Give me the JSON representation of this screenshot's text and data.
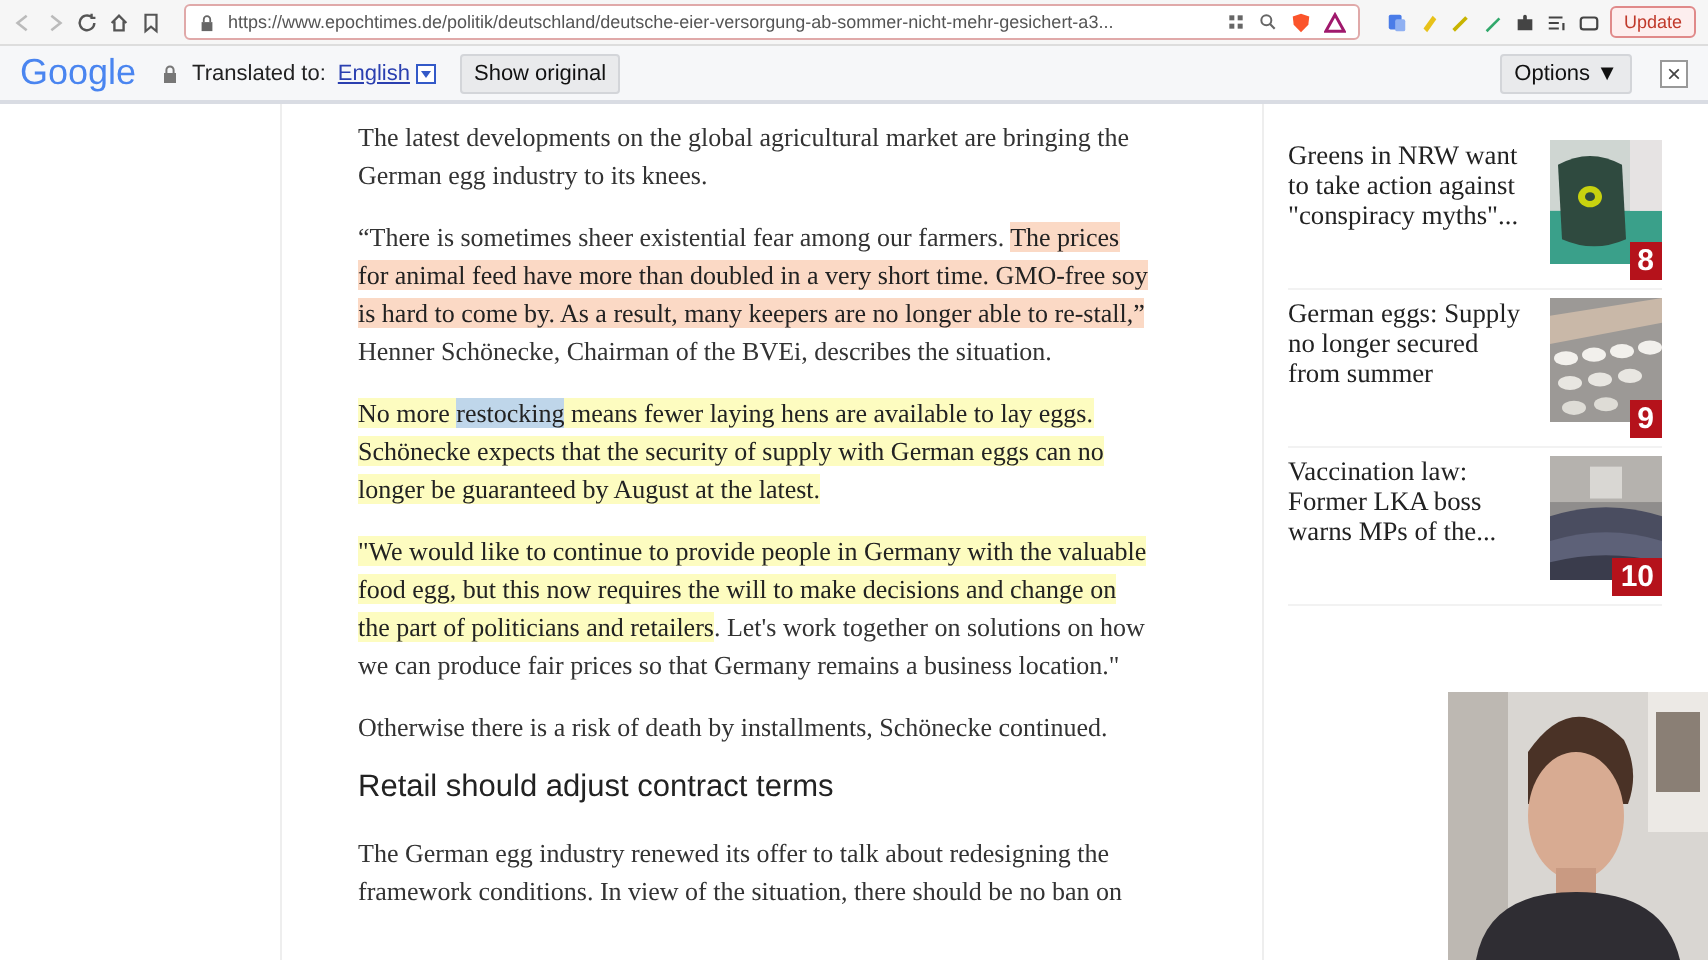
{
  "browser": {
    "url": "https://www.epochtimes.de/politik/deutschland/deutsche-eier-versorgung-ab-sommer-nicht-mehr-gesichert-a3...",
    "update_label": "Update"
  },
  "translate_bar": {
    "logo": "Google",
    "label": "Translated to:",
    "language": "English",
    "show_original": "Show original",
    "options": "Options ▼",
    "close": "×"
  },
  "article": {
    "blocks": [
      {
        "kind": "paragraph",
        "segments": [
          {
            "text": "The latest developments on the global agricultural market are bringing the German egg industry to its knees."
          }
        ]
      },
      {
        "kind": "paragraph",
        "segments": [
          {
            "text": "“There is sometimes sheer existential fear among our farmers. "
          },
          {
            "text": "The prices for animal feed have more than doubled in a very short time. GMO-free soy is hard to come by. As a result, many keepers are no longer able to re-stall,”",
            "color": "#fbd9c5"
          },
          {
            "text": " Henner Schönecke, Chairman of the BVEi, describes the situation."
          }
        ]
      },
      {
        "kind": "paragraph",
        "segments": [
          {
            "text": "No more ",
            "color": "#fdfcc0"
          },
          {
            "text": "restocking",
            "color": "#bfd6ea"
          },
          {
            "text": " means fewer laying hens are available to lay eggs. Schönecke expects that the security of supply with German eggs can no longer be guaranteed by August at the latest.",
            "color": "#fdfcc0"
          }
        ]
      },
      {
        "kind": "paragraph",
        "segments": [
          {
            "text": "\"We would like to continue to provide people in Germany with the valuable food egg, but this now requires the will to make decisions and change on the part of politicians and retailers",
            "color": "#fdfcc0"
          },
          {
            "text": ". Let's work together on solutions on how we can produce fair prices so that Germany remains a business location.\""
          }
        ]
      },
      {
        "kind": "paragraph",
        "segments": [
          {
            "text": "Otherwise there is a risk of death by installments, Schönecke continued."
          }
        ]
      },
      {
        "kind": "heading",
        "segments": [
          {
            "text": "Retail should adjust contract terms"
          }
        ]
      },
      {
        "kind": "paragraph",
        "segments": [
          {
            "text": "The German egg industry renewed its offer to talk about redesigning the framework conditions. In view of the situation, there should be no ban on"
          }
        ]
      }
    ]
  },
  "sidebar": {
    "items": [
      {
        "title": "Greens in NRW want to take action against \"conspiracy myths\"...",
        "rank": "8"
      },
      {
        "title": "German eggs: Supply no longer secured from summer",
        "rank": "9"
      },
      {
        "title": "Vaccination law: Former LKA boss warns MPs of the...",
        "rank": "10"
      }
    ]
  }
}
